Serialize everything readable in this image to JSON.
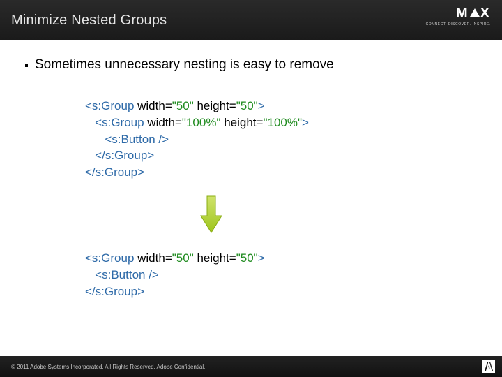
{
  "header": {
    "title": "Minimize Nested Groups",
    "brand": "MAX",
    "brand_sub": "CONNECT. DISCOVER. INSPIRE."
  },
  "bullet": "Sometimes unnecessary nesting is easy to remove",
  "code_before": [
    [
      {
        "t": "tag",
        "v": "<s:Group"
      },
      {
        "t": "attr",
        "v": " width="
      },
      {
        "t": "val",
        "v": "\"50\""
      },
      {
        "t": "attr",
        "v": " height="
      },
      {
        "t": "val",
        "v": "\"50\""
      },
      {
        "t": "tag",
        "v": ">"
      }
    ],
    [
      {
        "t": "attr",
        "v": "   "
      },
      {
        "t": "tag",
        "v": "<s:Group"
      },
      {
        "t": "attr",
        "v": " width="
      },
      {
        "t": "val",
        "v": "\"100%\""
      },
      {
        "t": "attr",
        "v": " height="
      },
      {
        "t": "val",
        "v": "\"100%\""
      },
      {
        "t": "tag",
        "v": ">"
      }
    ],
    [
      {
        "t": "attr",
        "v": "      "
      },
      {
        "t": "tag",
        "v": "<s:Button />"
      }
    ],
    [
      {
        "t": "attr",
        "v": "   "
      },
      {
        "t": "tag",
        "v": "</s:Group>"
      }
    ],
    [
      {
        "t": "tag",
        "v": "</s:Group>"
      }
    ]
  ],
  "code_after": [
    [
      {
        "t": "tag",
        "v": "<s:Group"
      },
      {
        "t": "attr",
        "v": " width="
      },
      {
        "t": "val",
        "v": "\"50\""
      },
      {
        "t": "attr",
        "v": " height="
      },
      {
        "t": "val",
        "v": "\"50\""
      },
      {
        "t": "tag",
        "v": ">"
      }
    ],
    [
      {
        "t": "attr",
        "v": "   "
      },
      {
        "t": "tag",
        "v": "<s:Button />"
      }
    ],
    [
      {
        "t": "tag",
        "v": "</s:Group>"
      }
    ]
  ],
  "footer": "© 2011 Adobe Systems Incorporated.  All Rights Reserved.  Adobe Confidential."
}
